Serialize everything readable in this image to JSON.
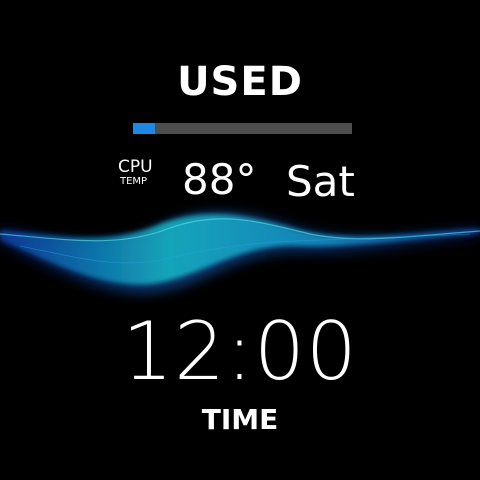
{
  "header": {
    "title": "USED"
  },
  "usage_bar": {
    "fraction": 0.1,
    "fill_color": "#1e88e5",
    "track_color": "#4d4d4d"
  },
  "cpu": {
    "label_line1": "CPU",
    "label_line2": "TEMP",
    "temperature": "88°"
  },
  "date": {
    "day": "Sat"
  },
  "clock": {
    "time": "12:00",
    "label": "TIME"
  },
  "colors": {
    "background": "#000000",
    "text": "#ffffff",
    "wave_cyan": "#19c7c9",
    "wave_blue": "#1a5fd6"
  }
}
